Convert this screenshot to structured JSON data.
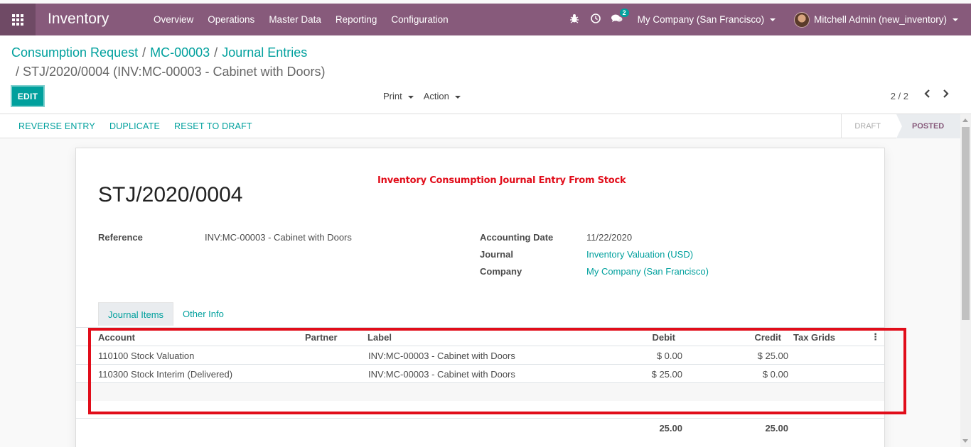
{
  "navbar": {
    "app_name": "Inventory",
    "menu": [
      "Overview",
      "Operations",
      "Master Data",
      "Reporting",
      "Configuration"
    ],
    "icons": [
      "bug-icon",
      "clock-icon",
      "chat-icon"
    ],
    "chat_badge": "2",
    "company": "My Company (San Francisco)",
    "user": "Mitchell Admin (new_inventory)"
  },
  "breadcrumb": {
    "items": [
      "Consumption Request",
      "MC-00003",
      "Journal Entries"
    ],
    "current": "STJ/2020/0004 (INV:MC-00003 - Cabinet with Doors)"
  },
  "controls": {
    "edit_label": "EDIT",
    "print_label": "Print",
    "action_label": "Action",
    "pager": "2 / 2"
  },
  "statusbar": {
    "buttons": [
      "REVERSE ENTRY",
      "DUPLICATE",
      "RESET TO DRAFT"
    ],
    "states": [
      "DRAFT",
      "POSTED"
    ],
    "active_state": "POSTED"
  },
  "annotation": "Inventory Consumption Journal Entry From Stock",
  "entry": {
    "name": "STJ/2020/0004",
    "reference_label": "Reference",
    "reference": "INV:MC-00003 - Cabinet with Doors",
    "accounting_date_label": "Accounting Date",
    "accounting_date": "11/22/2020",
    "journal_label": "Journal",
    "journal": "Inventory Valuation (USD)",
    "company_label": "Company",
    "company": "My Company (San Francisco)"
  },
  "tabs": [
    "Journal Items",
    "Other Info"
  ],
  "journal_items": {
    "columns": [
      "Account",
      "Partner",
      "Label",
      "Debit",
      "Credit",
      "Tax Grids"
    ],
    "rows": [
      {
        "account": "110100 Stock Valuation",
        "partner": "",
        "label": "INV:MC-00003 - Cabinet with Doors",
        "debit": "$ 0.00",
        "credit": "$ 25.00",
        "tax_grids": ""
      },
      {
        "account": "110300 Stock Interim (Delivered)",
        "partner": "",
        "label": "INV:MC-00003 - Cabinet with Doors",
        "debit": "$ 25.00",
        "credit": "$ 0.00",
        "tax_grids": ""
      }
    ],
    "total_debit": "25.00",
    "total_credit": "25.00"
  },
  "colors": {
    "brand": "#875a7b",
    "accent": "#00a09d",
    "highlight": "#e10d1a"
  }
}
